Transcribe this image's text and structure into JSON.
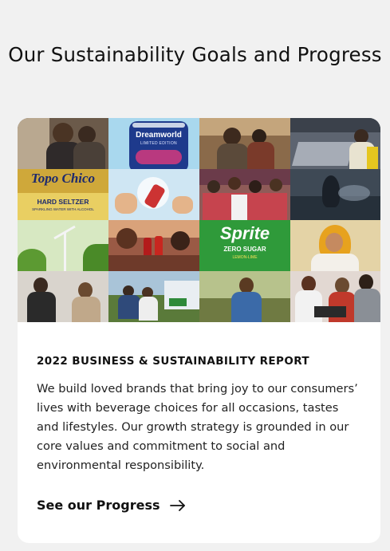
{
  "section": {
    "title": "Our Sustainability Goals and Progress"
  },
  "card": {
    "mosaic": {
      "tiles": [
        {
          "name": "photo-people-street",
          "bg": "#6b5a4a"
        },
        {
          "name": "photo-dreamworld-can",
          "bg": "#a9d8ee"
        },
        {
          "name": "photo-people-market",
          "bg": "#8a6a4a"
        },
        {
          "name": "photo-recycling-facility",
          "bg": "#5d6470"
        },
        {
          "name": "photo-topo-chico-can",
          "bg": "#e9cf62"
        },
        {
          "name": "photo-bottle-splash",
          "bg": "#cfe6f3"
        },
        {
          "name": "photo-crowd-celebration",
          "bg": "#8f5b58"
        },
        {
          "name": "photo-dark-water",
          "bg": "#3e4955"
        },
        {
          "name": "photo-wind-turbine-leaves",
          "bg": "#a8c97a"
        },
        {
          "name": "photo-friends-toast",
          "bg": "#9a5a45"
        },
        {
          "name": "photo-sprite-can",
          "bg": "#4db84a"
        },
        {
          "name": "photo-woman-hijab",
          "bg": "#d9b66e"
        },
        {
          "name": "photo-office-meeting",
          "bg": "#7a6e64"
        },
        {
          "name": "photo-people-outdoors",
          "bg": "#6b8aa3"
        },
        {
          "name": "photo-orchard-worker",
          "bg": "#8fa06a"
        },
        {
          "name": "photo-colleagues-laptop",
          "bg": "#b88a7a"
        }
      ],
      "labels": {
        "dreamworld": "Dreamworld",
        "dreamworld_sub": "LIMITED EDITION",
        "topo_brand": "Topo Chico",
        "topo_product": "HARD SELTZER",
        "topo_sub": "SPARKLING WATER WITH ALCOHOL",
        "sprite_brand": "Sprite",
        "sprite_sub": "ZERO SUGAR",
        "sprite_flavor": "LEMON-LIME"
      }
    },
    "report_title": "2022 BUSINESS & SUSTAINABILITY REPORT",
    "description": "We build loved brands that bring joy to our consumers’ lives with beverage choices for all occasions, tastes and lifestyles. Our growth strategy is grounded in our core values and commitment to social and environmental responsibility.",
    "cta_label": "See our Progress",
    "cta_icon": "arrow-right-icon"
  }
}
